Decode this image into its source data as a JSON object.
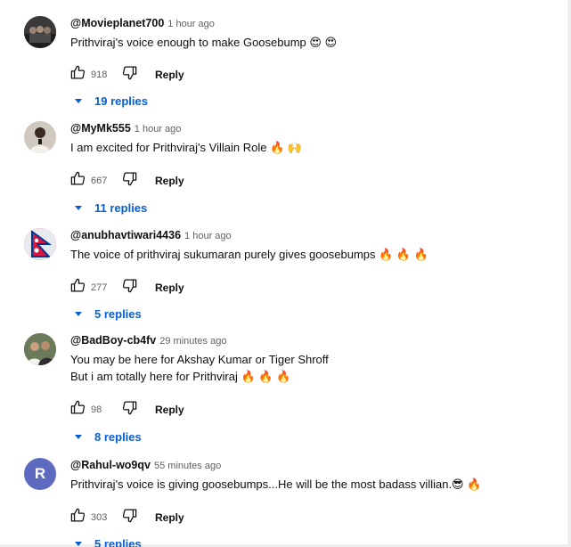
{
  "comments": [
    {
      "author": "@Movieplanet700",
      "time": "1 hour ago",
      "text": "Prithviraj's voice enough to make Goosebump 😍 😍",
      "likes": "918",
      "reply_label": "Reply",
      "replies_label": "19 replies",
      "avatar": {
        "style": "photo-group",
        "color": "#3a3a3a"
      }
    },
    {
      "author": "@MyMk555",
      "time": "1 hour ago",
      "text": "I am excited for Prithviraj's Villain Role 🔥 🙌",
      "likes": "667",
      "reply_label": "Reply",
      "replies_label": "11 replies",
      "avatar": {
        "style": "photo-person",
        "color": "#cfc9c0"
      }
    },
    {
      "author": "@anubhavtiwari4436",
      "time": "1 hour ago",
      "text": "The voice of prithviraj sukumaran purely gives goosebumps 🔥 🔥 🔥",
      "likes": "277",
      "reply_label": "Reply",
      "replies_label": "5 replies",
      "avatar": {
        "style": "flag-nepal",
        "color": "#dc143c"
      }
    },
    {
      "author": "@BadBoy-cb4fv",
      "time": "29 minutes ago",
      "text": "You may be here for Akshay Kumar or Tiger Shroff\nBut i am totally here for Prithviraj 🔥 🔥 🔥",
      "likes": "98",
      "reply_label": "Reply",
      "replies_label": "8 replies",
      "avatar": {
        "style": "photo-duo",
        "color": "#6b7a5a"
      }
    },
    {
      "author": "@Rahul-wo9qv",
      "time": "55 minutes ago",
      "text": "Prithviraj's voice is giving goosebumps...He will be the most badass villian.😎 🔥",
      "likes": "303",
      "reply_label": "Reply",
      "replies_label": "5 replies",
      "avatar": {
        "style": "initial",
        "initial": "R",
        "color": "#5c6bc0"
      }
    }
  ]
}
